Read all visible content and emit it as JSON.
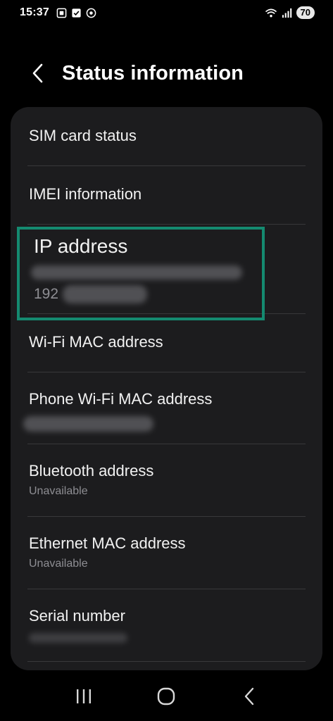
{
  "status_bar": {
    "time": "15:37",
    "battery": "70",
    "left_icons": [
      "screenshot-icon",
      "checkbox-icon",
      "vpn-icon"
    ],
    "right_icons": [
      "wifi-icon",
      "signal-icon"
    ]
  },
  "header": {
    "title": "Status information",
    "back_icon": "chevron-left-icon"
  },
  "items": [
    {
      "title": "SIM card status"
    },
    {
      "title": "IMEI information"
    },
    {
      "title": "IP address",
      "value_visible": "192"
    },
    {
      "title": "Wi-Fi MAC address"
    },
    {
      "title": "Phone Wi-Fi MAC address"
    },
    {
      "title": "Bluetooth address",
      "subtitle": "Unavailable"
    },
    {
      "title": "Ethernet MAC address",
      "subtitle": "Unavailable"
    },
    {
      "title": "Serial number"
    }
  ],
  "highlight": {
    "target": "IP address",
    "color": "#148a70"
  },
  "colors": {
    "background": "#000000",
    "card": "#1c1c1e",
    "divider": "#38383a",
    "subtitle": "#8e8e93"
  },
  "nav_bar": {
    "icons": [
      "recent-apps-icon",
      "home-icon",
      "back-icon"
    ]
  }
}
